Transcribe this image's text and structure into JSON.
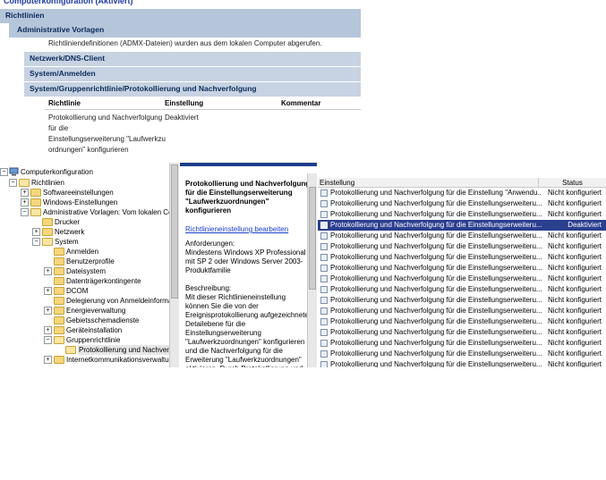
{
  "report": {
    "title": "Computerkonfiguration (Aktiviert)",
    "bar_richtlinien": "Richtlinien",
    "bar_admin": "Administrative Vorlagen",
    "info": "Richtliniendefinitionen (ADMX-Dateien) wurden aus dem lokalen Computer abgerufen.",
    "bar_netz": "Netzwerk/DNS-Client",
    "bar_system": "System/Anmelden",
    "bar_gruppe": "System/Gruppenrichtlinie/Protokollierung und Nachverfolgung",
    "col_policy": "Richtlinie",
    "col_setting": "Einstellung",
    "col_comment": "Kommentar",
    "policy_lines": [
      "Protokollierung und Nachverfolgung",
      "für die",
      "Einstellungserweiterung \"Laufwerkzu",
      "ordnungen\" konfigurieren"
    ],
    "policy_setting": "Deaktiviert"
  },
  "tree": {
    "root": "Computerkonfiguration",
    "items": [
      "Richtlinien",
      "Softwareeinstellungen",
      "Windows-Einstellungen",
      "Administrative Vorlagen: Vom lokalen Com",
      "Drucker",
      "Netzwerk",
      "System",
      "Anmelden",
      "Benutzerprofile",
      "Dateisystem",
      "Datenträgerkontingente",
      "DCOM",
      "Delegierung von Anmeldeinformat",
      "Energieverwaltung",
      "Gebietsschemadienste",
      "Geräteinstallation",
      "Gruppenrichtlinie",
      "Protokollierung und Nachverfo",
      "Internetkommunikationsverwaltur"
    ]
  },
  "description": {
    "title": "Protokollierung und Nachverfolgung für die Einstellungserweiterung \"Laufwerkzuordnungen\" konfigurieren",
    "edit_link": "Richtlinieneinstellung bearbeiten",
    "body": "Anforderungen:\nMindestens Windows XP Professional mit SP 2 oder Windows Server 2003-Produktfamilie\n\nBeschreibung:\nMit dieser Richtlinieneinstellung können Sie die von der Ereignisprotokollierung aufgezeichnete Detailebene für die Einstellungserweiterung \"Laufwerkzuordnungen\" konfigurieren und die Nachverfolgung für die Erweiterung \"Laufwerkzuordnungen\" aktivieren. Durch Protokollierung und Nachverfolgung werden"
  },
  "list": {
    "col_setting": "Einstellung",
    "col_status": "Status",
    "rows": [
      {
        "name": "Protokollierung und Nachverfolgung für die Einstellung \"Anwendu...",
        "status": "Nicht konfiguriert"
      },
      {
        "name": "Protokollierung und Nachverfolgung für die Einstellungserweiteru...",
        "status": "Nicht konfiguriert"
      },
      {
        "name": "Protokollierung und Nachverfolgung für die Einstellungserweiteru...",
        "status": "Nicht konfiguriert"
      },
      {
        "name": "Protokollierung und Nachverfolgung für die Einstellungserweiteru...",
        "status": "Deaktiviert"
      },
      {
        "name": "Protokollierung und Nachverfolgung für die Einstellungserweiteru...",
        "status": "Nicht konfiguriert"
      },
      {
        "name": "Protokollierung und Nachverfolgung für die Einstellungserweiteru...",
        "status": "Nicht konfiguriert"
      },
      {
        "name": "Protokollierung und Nachverfolgung für die Einstellungserweiteru...",
        "status": "Nicht konfiguriert"
      },
      {
        "name": "Protokollierung und Nachverfolgung für die Einstellungserweiteru...",
        "status": "Nicht konfiguriert"
      },
      {
        "name": "Protokollierung und Nachverfolgung für die Einstellungserweiteru...",
        "status": "Nicht konfiguriert"
      },
      {
        "name": "Protokollierung und Nachverfolgung für die Einstellungserweiteru...",
        "status": "Nicht konfiguriert"
      },
      {
        "name": "Protokollierung und Nachverfolgung für die Einstellungserweiteru...",
        "status": "Nicht konfiguriert"
      },
      {
        "name": "Protokollierung und Nachverfolgung für die Einstellungserweiteru...",
        "status": "Nicht konfiguriert"
      },
      {
        "name": "Protokollierung und Nachverfolgung für die Einstellungserweiteru...",
        "status": "Nicht konfiguriert"
      },
      {
        "name": "Protokollierung und Nachverfolgung für die Einstellungserweiteru...",
        "status": "Nicht konfiguriert"
      },
      {
        "name": "Protokollierung und Nachverfolgung für die Einstellungserweiteru...",
        "status": "Nicht konfiguriert"
      },
      {
        "name": "Protokollierung und Nachverfolgung für die Einstellungserweiteru...",
        "status": "Nicht konfiguriert"
      },
      {
        "name": "Protokollierung und Nachverfolgung für die Einstellungserweiteru...",
        "status": "Nicht konfiguriert"
      }
    ]
  },
  "colors": {
    "selection": "#2b3f8f",
    "header_bar": "#b5c6da",
    "link": "#1a3ed1"
  }
}
